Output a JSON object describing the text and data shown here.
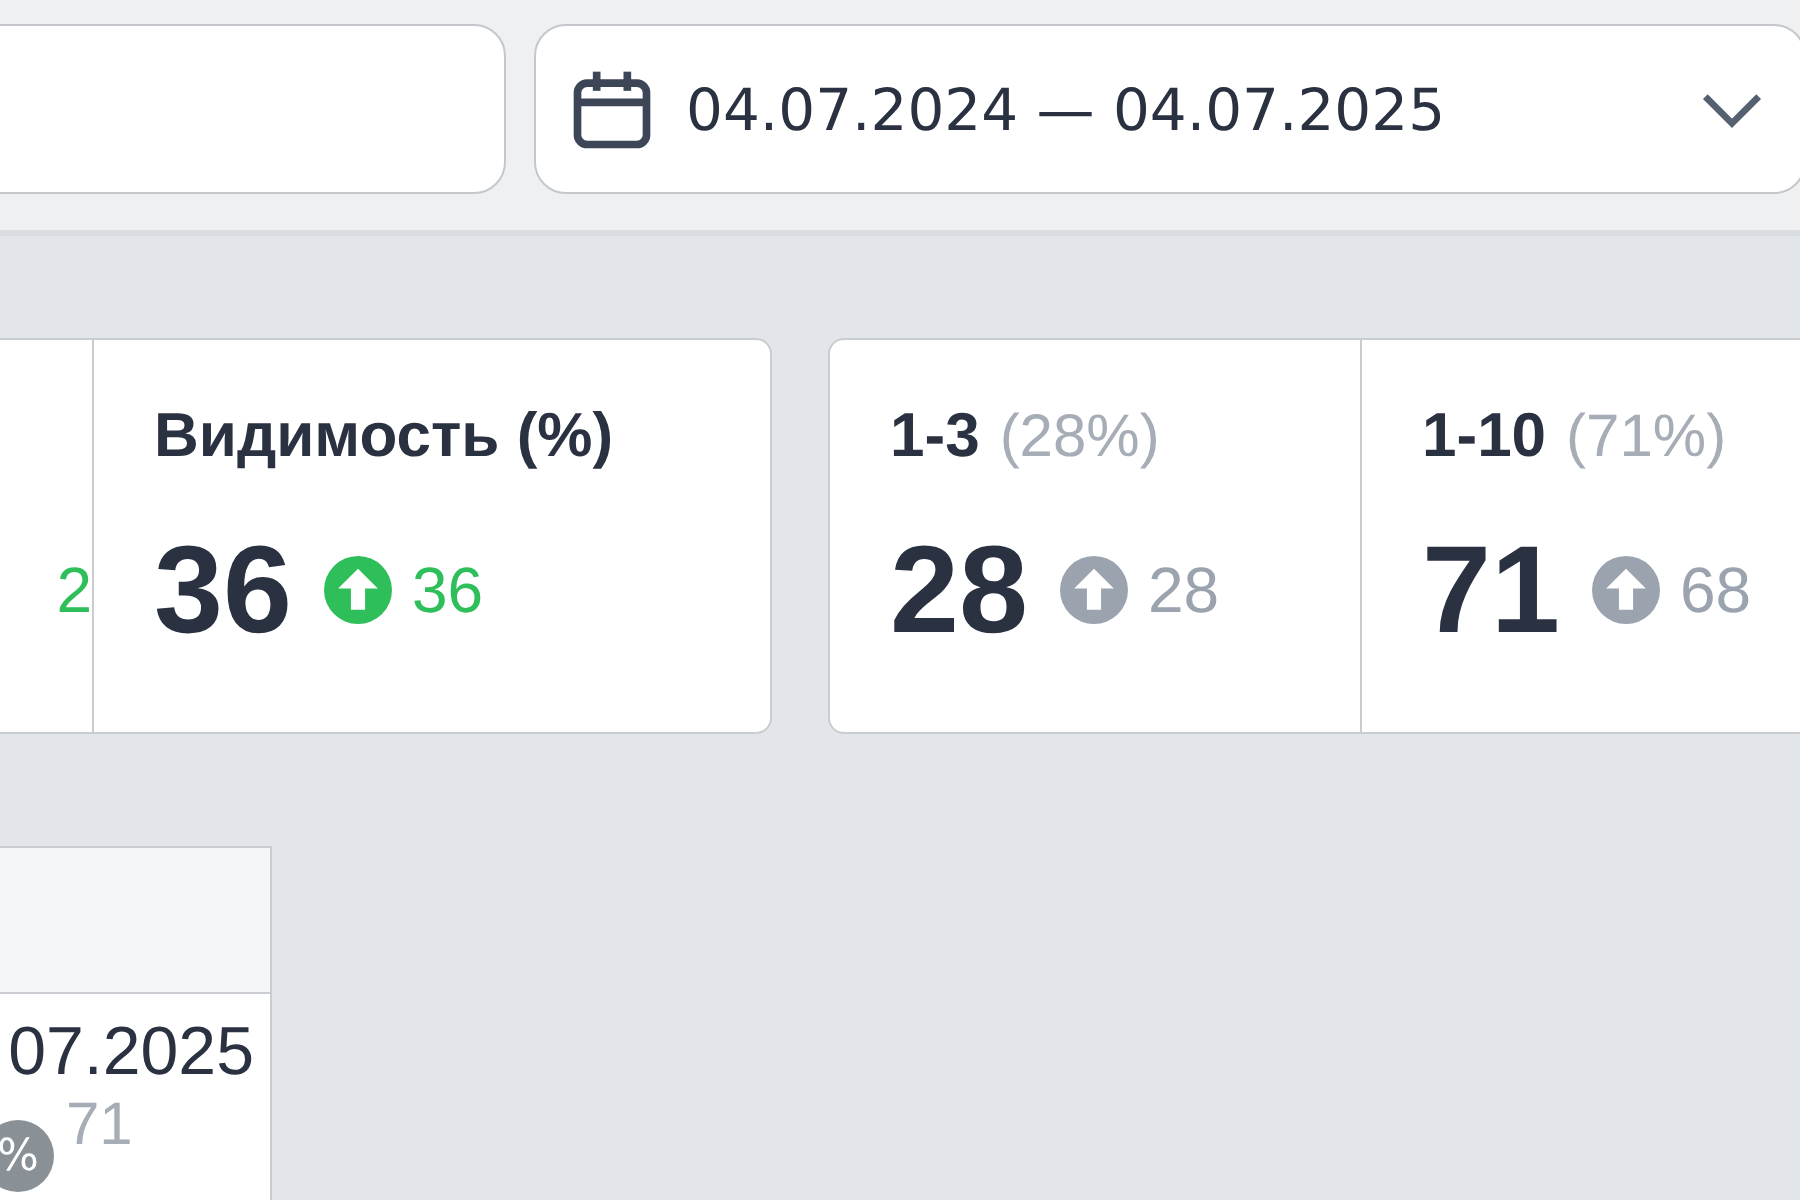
{
  "toolbar": {
    "date_range": {
      "value": "04.07.2024 — 04.07.2025"
    }
  },
  "metric_groups": [
    {
      "cards": [
        {
          "change": "2",
          "color": "#2fbf5a"
        },
        {
          "title": "Видимость (%)",
          "value": "36",
          "change": "36",
          "color": "#2fbf5a"
        }
      ]
    },
    {
      "cards": [
        {
          "title": "1-3",
          "share": "(28%)",
          "value": "28",
          "change": "28",
          "color": "#9aa3ae"
        },
        {
          "title": "1-10",
          "share": "(71%)",
          "value": "71",
          "change": "68",
          "color": "#9aa3ae"
        }
      ]
    }
  ],
  "table": {
    "rows": [
      {
        "date": "07.2025",
        "badge": "%",
        "value": "71"
      }
    ]
  }
}
